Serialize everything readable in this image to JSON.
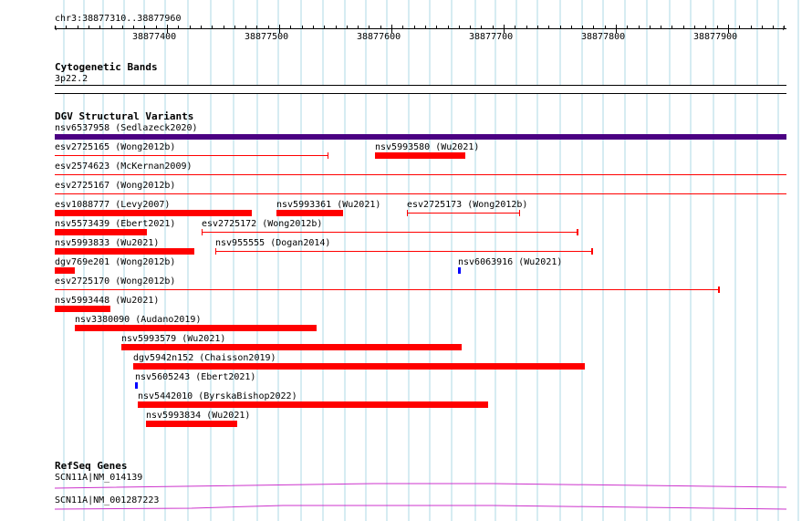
{
  "colors": {
    "grid": "#add8e6",
    "sv_thick": "#ff0000",
    "sv_thin": "#ff0000",
    "sv_blue": "#0000ff",
    "sedlazeck": "#4b0082",
    "refseq": "#cc33cc",
    "band_line": "#000000"
  },
  "ruler": {
    "region": "chr3:38877310..38877960",
    "ticks": [
      "38877400",
      "38877500",
      "38877600",
      "38877700",
      "38877800",
      "38877900"
    ]
  },
  "tracks": {
    "cytoband": {
      "title": "Cytogenetic Bands",
      "band": "3p22.2"
    },
    "dgv": {
      "title": "DGV Structural Variants",
      "features": [
        {
          "label": "nsv6537958 (Sedlazeck2020)"
        },
        {
          "label": "esv2725165 (Wong2012b)"
        },
        {
          "label": "nsv5993580 (Wu2021)"
        },
        {
          "label": "esv2574623 (McKernan2009)"
        },
        {
          "label": "esv2725167 (Wong2012b)"
        },
        {
          "label": "esv1088777 (Levy2007)"
        },
        {
          "label": "nsv5993361 (Wu2021)"
        },
        {
          "label": "esv2725173 (Wong2012b)"
        },
        {
          "label": "nsv5573439 (Ebert2021)"
        },
        {
          "label": "esv2725172 (Wong2012b)"
        },
        {
          "label": "nsv5993833 (Wu2021)"
        },
        {
          "label": "nsv955555 (Dogan2014)"
        },
        {
          "label": "dgv769e201 (Wong2012b)"
        },
        {
          "label": "nsv6063916 (Wu2021)"
        },
        {
          "label": "esv2725170 (Wong2012b)"
        },
        {
          "label": "nsv5993448 (Wu2021)"
        },
        {
          "label": "nsv3380090 (Audano2019)"
        },
        {
          "label": "nsv5993579 (Wu2021)"
        },
        {
          "label": "dgv5942n152 (Chaisson2019)"
        },
        {
          "label": "nsv5605243 (Ebert2021)"
        },
        {
          "label": "nsv5442010 (ByrskaBishop2022)"
        },
        {
          "label": "nsv5993834 (Wu2021)"
        }
      ]
    },
    "refseq": {
      "title": "RefSeq Genes",
      "features": [
        {
          "label": "SCN11A|NM_014139"
        },
        {
          "label": "SCN11A|NM_001287223"
        }
      ]
    }
  }
}
